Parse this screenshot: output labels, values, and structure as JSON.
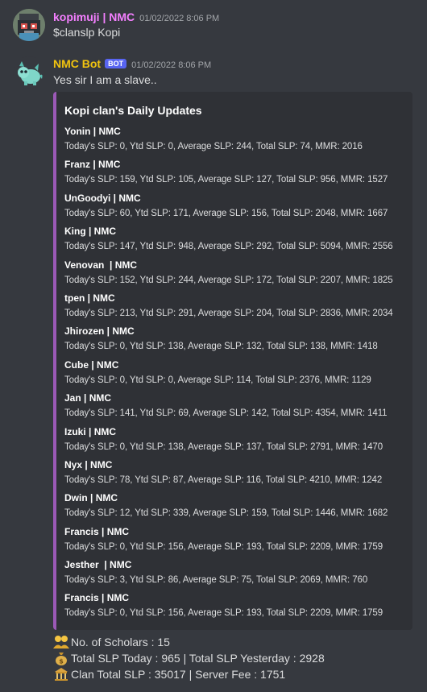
{
  "messages": [
    {
      "author": "kopimuji | NMC",
      "author_color": "#f47fff",
      "timestamp": "01/02/2022 8:06 PM",
      "text": "$clanslp Kopi",
      "avatar_icon": "pixel-robot-avatar"
    },
    {
      "author": "NMC Bot",
      "author_color": "#f1c40f",
      "bot_tag": "BOT",
      "timestamp": "01/02/2022 8:06 PM",
      "text": "Yes sir I am a slave..",
      "avatar_icon": "axie-creature-avatar"
    }
  ],
  "embed": {
    "accent_color": "#9b59b6",
    "title": "Kopi clan's Daily Updates",
    "fields": [
      {
        "name": "Yonin | NMC",
        "value": "Today's SLP: 0, Ytd SLP: 0, Average SLP: 244, Total SLP: 74, MMR: 2016"
      },
      {
        "name": "Franz | NMC",
        "value": "Today's SLP: 159, Ytd SLP: 105, Average SLP: 127, Total SLP: 956, MMR: 1527"
      },
      {
        "name": "UnGoodyi | NMC",
        "value": "Today's SLP: 60, Ytd SLP: 171, Average SLP: 156, Total SLP: 2048, MMR: 1667"
      },
      {
        "name": "King | NMC",
        "value": "Today's SLP: 147, Ytd SLP: 948, Average SLP: 292, Total SLP: 5094, MMR: 2556"
      },
      {
        "name": "Venovan  | NMC",
        "value": "Today's SLP: 152, Ytd SLP: 244, Average SLP: 172, Total SLP: 2207, MMR: 1825"
      },
      {
        "name": "tpen | NMC",
        "value": "Today's SLP: 213, Ytd SLP: 291, Average SLP: 204, Total SLP: 2836, MMR: 2034"
      },
      {
        "name": "Jhirozen | NMC",
        "value": "Today's SLP: 0, Ytd SLP: 138, Average SLP: 132, Total SLP: 138, MMR: 1418"
      },
      {
        "name": "Cube | NMC",
        "value": "Today's SLP: 0, Ytd SLP: 0, Average SLP: 114, Total SLP: 2376, MMR: 1129"
      },
      {
        "name": "Jan | NMC",
        "value": "Today's SLP: 141, Ytd SLP: 69, Average SLP: 142, Total SLP: 4354, MMR: 1411"
      },
      {
        "name": "Izuki | NMC",
        "value": "Today's SLP: 0, Ytd SLP: 138, Average SLP: 137, Total SLP: 2791, MMR: 1470"
      },
      {
        "name": "Nyx | NMC",
        "value": "Today's SLP: 78, Ytd SLP: 87, Average SLP: 116, Total SLP: 4210, MMR: 1242"
      },
      {
        "name": "Dwin | NMC",
        "value": "Today's SLP: 12, Ytd SLP: 339, Average SLP: 159, Total SLP: 1446, MMR: 1682"
      },
      {
        "name": "Francis | NMC",
        "value": "Today's SLP: 0, Ytd SLP: 156, Average SLP: 193, Total SLP: 2209, MMR: 1759"
      },
      {
        "name": "Jesther  | NMC",
        "value": "Today's SLP: 3, Ytd SLP: 86, Average SLP: 75, Total SLP: 2069, MMR: 760"
      },
      {
        "name": "Francis | NMC",
        "value": "Today's SLP: 0, Ytd SLP: 156, Average SLP: 193, Total SLP: 2209, MMR: 1759"
      }
    ]
  },
  "summary": [
    {
      "icon": "people-emoji-icon",
      "text": "No. of Scholars : 15"
    },
    {
      "icon": "money-bag-emoji-icon",
      "text": "Total SLP Today : 965  |  Total SLP Yesterday : 2928"
    },
    {
      "icon": "bank-emoji-icon",
      "text": "Clan Total SLP : 35017  |  Server Fee : 1751"
    }
  ]
}
